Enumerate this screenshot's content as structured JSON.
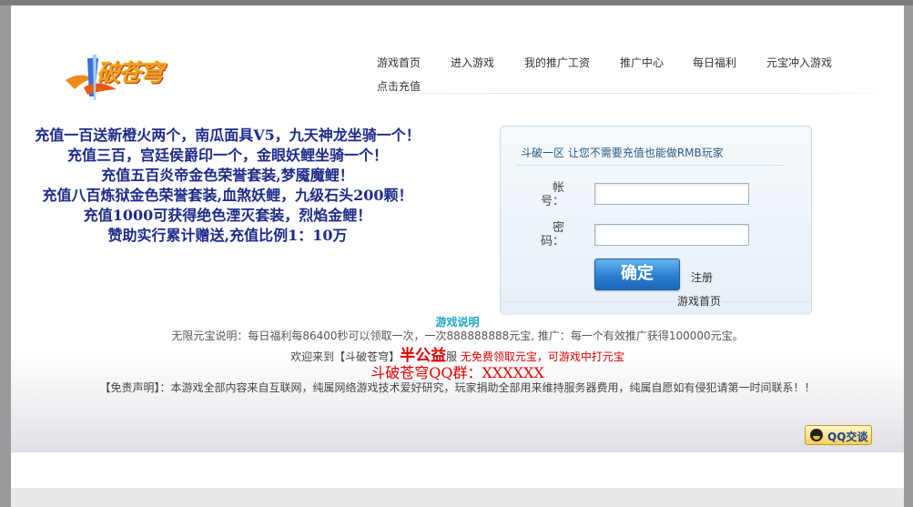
{
  "logo": {
    "text": "破苍穹"
  },
  "nav": {
    "items": [
      "游戏首页",
      "进入游戏",
      "我的推广工资",
      "推广中心",
      "每日福利",
      "元宝冲入游戏",
      "点击充值"
    ]
  },
  "promo": {
    "lines": [
      "充值一百送新橙火两个，南瓜面具V5，九天神龙坐骑一个！",
      "充值三百，宫廷侯爵印一个，金眼妖鲤坐骑一个！",
      "充值五百炎帝金色荣誉套装,梦魇魔鲤！",
      "充值八百炼狱金色荣誉套装,血煞妖鲤，九级石头200颗！",
      "充值1000可获得绝色湮灭套装，烈焰金鲤！",
      "赞助实行累计赠送,充值比例1：10万"
    ]
  },
  "login": {
    "header": "斗破一区 让您不需要充值也能做RMB玩家",
    "account_label": "帐号：",
    "account_value": "",
    "password_label": "密码：",
    "password_value": "",
    "confirm_label": "确定",
    "register_label": "注册",
    "home_label": "游戏首页"
  },
  "info": {
    "title": "游戏说明",
    "line1": "无限元宝说明：每日福利每86400秒可以领取一次，一次888888888元宝, 推广：每一个有效推广获得100000元宝。",
    "line2_prefix": "欢迎来到【斗破苍穹】",
    "line2_big": "半公益",
    "line2_mid": "服 ",
    "line2_red": "无免费领取元宝，可游戏中打元宝",
    "qq_group": "斗破苍穹QQ群：XXXXXX",
    "disclaimer": "【免责声明】：本游戏全部内容来自互联网，纯属网络游戏技术爱好研究，玩家捐助全部用来维持服务器费用，纯属自愿如有侵犯请第一时间联系！！"
  },
  "qq_button": {
    "label": "QQ交谈",
    "icon": "qq-penguin-icon"
  },
  "colors": {
    "promo_text": "#1d2b8a",
    "accent_red": "#e00000",
    "info_title": "#1fa7c9",
    "button_blue": "#2b7fd0"
  }
}
